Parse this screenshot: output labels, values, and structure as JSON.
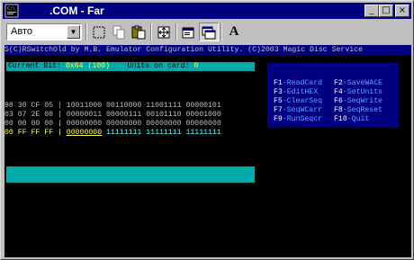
{
  "window": {
    "title": ".COM - Far",
    "buttons": {
      "minimize": "_",
      "maximize": "□",
      "close": "×"
    }
  },
  "toolbar": {
    "font_combo": "Авто",
    "buttons": [
      "mark-icon",
      "copy-icon",
      "paste-icon",
      "fullscreen-icon",
      "properties-icon",
      "background-icon",
      "font-icon"
    ],
    "font_button": "A"
  },
  "console": {
    "program_line": "S(C)RSwitchOld by M.B. Emulator Configuration Utility. (C)2003 Magic Disc Service",
    "current_bit_label": "Current Bit: ",
    "current_bit_value": "0x64 (100)",
    "units_label": "Units on card: ",
    "units_value": "0",
    "rows": [
      {
        "hex": "98 30 CF 05",
        "bin": "10011000 00110000 11001111 00000101"
      },
      {
        "hex": "03 07 2E 08",
        "bin": "00000011 00000111 00101110 00001000"
      },
      {
        "hex": "00 00 00 00",
        "bin": "00000000 00000000 00000000 00000000"
      },
      {
        "hex": "00 FF FF FF",
        "bin_cursor": "00000000",
        "bin_rest": " 11111111 11111111 11111111"
      }
    ],
    "keys": [
      {
        "key": "F1",
        "label": "-ReadCard"
      },
      {
        "key": "F2",
        "label": "-SaveWACE"
      },
      {
        "key": "F3",
        "label": "-EditHEX"
      },
      {
        "key": "F4",
        "label": "-SetUnits"
      },
      {
        "key": "F5",
        "label": "-ClearSeq"
      },
      {
        "key": "F6",
        "label": "-SeqWrite"
      },
      {
        "key": "F7",
        "label": "-SeqWCarr"
      },
      {
        "key": "F8",
        "label": "-SeqReset"
      },
      {
        "key": "F9",
        "label": "-RunSeqcr"
      },
      {
        "key": "F10",
        "label": "-Quit"
      }
    ]
  },
  "colors": {
    "titlebar": "#000080",
    "console_bg": "#000000",
    "cyan": "#00aaaa",
    "yellow": "#ffff55",
    "key_label": "#55aaff"
  }
}
